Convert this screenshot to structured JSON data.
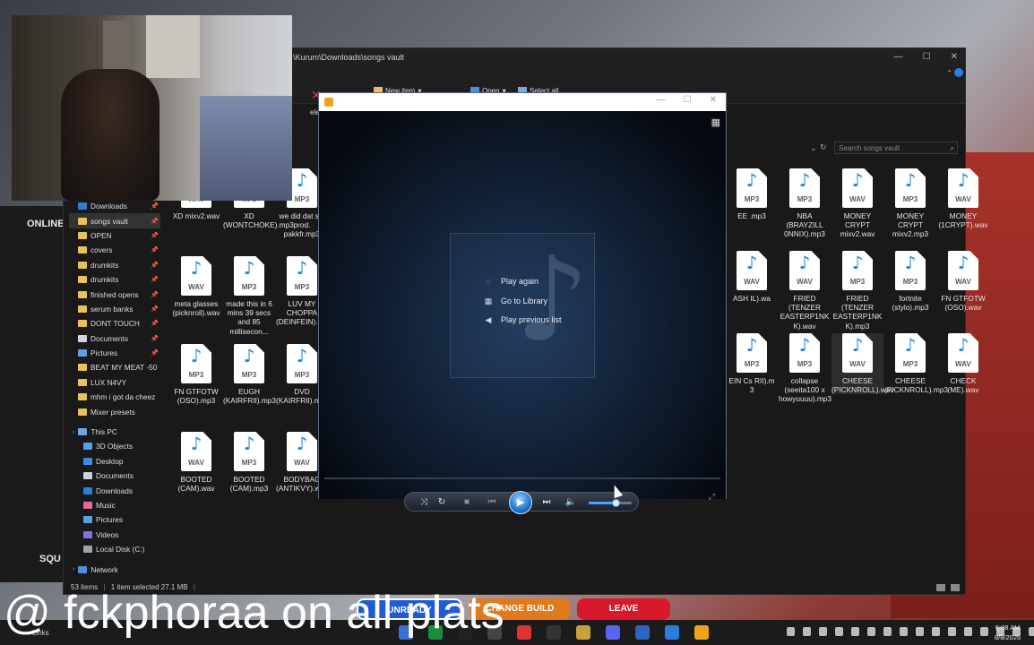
{
  "explorer": {
    "address": "\\Kurum\\Downloads\\songs vault",
    "search_placeholder": "Search songs vault",
    "ribbon": {
      "delete_label": "elete",
      "new_item_label": "New item",
      "open_label": "Open",
      "select_all_label": "Select all"
    },
    "sidebar": {
      "quick_access": [
        {
          "label": "Downloads",
          "pinned": true
        },
        {
          "label": "songs vault",
          "pinned": true,
          "selected": true
        },
        {
          "label": "OPEN",
          "pinned": true
        },
        {
          "label": "covers",
          "pinned": true
        },
        {
          "label": "drumkits",
          "pinned": true
        },
        {
          "label": "drumkits",
          "pinned": true
        },
        {
          "label": "finished opens",
          "pinned": true
        },
        {
          "label": "serum banks",
          "pinned": true
        },
        {
          "label": "DONT TOUCH",
          "pinned": true
        },
        {
          "label": "Documents",
          "pinned": true
        },
        {
          "label": "Pictures",
          "pinned": true
        },
        {
          "label": "BEAT MY MEAT -50",
          "pinned": false
        },
        {
          "label": "LUX N4VY",
          "pinned": false
        },
        {
          "label": "mhm i got da cheez",
          "pinned": false
        },
        {
          "label": "Mixer presets",
          "pinned": false
        }
      ],
      "this_pc_label": "This PC",
      "this_pc": [
        "3D Objects",
        "Desktop",
        "Documents",
        "Downloads",
        "Music",
        "Pictures",
        "Videos",
        "Local Disk (C:)"
      ],
      "network_label": "Network"
    },
    "files_left": [
      {
        "name": "XD mixv2.wav",
        "ext": "WAV",
        "col": 0,
        "row": 0
      },
      {
        "name": "XD (WONTCHOKE).mp3",
        "ext": "MP3",
        "col": 1,
        "row": 0
      },
      {
        "name": "we did dat shi prod. pakkfr.mp3",
        "ext": "MP3",
        "col": 2,
        "row": 0
      },
      {
        "name": "meta glasses (picknroll).wav",
        "ext": "WAV",
        "col": 0,
        "row": 1
      },
      {
        "name": "made this in 6 mins 39 secs and 85 millisecon...",
        "ext": "MP3",
        "col": 1,
        "row": 1
      },
      {
        "name": "LUV MY CHOPPA (DEINFEIN).mp3",
        "ext": "MP3",
        "col": 2,
        "row": 1
      },
      {
        "name": "FN GTFOTW (OSO).mp3",
        "ext": "MP3",
        "col": 0,
        "row": 2
      },
      {
        "name": "EUGH (KAIRFRII).mp3",
        "ext": "MP3",
        "col": 1,
        "row": 2
      },
      {
        "name": "DVD (KAIRFRII).mp3",
        "ext": "MP3",
        "col": 2,
        "row": 2
      },
      {
        "name": "BOOTED (CAM).wav",
        "ext": "WAV",
        "col": 0,
        "row": 3
      },
      {
        "name": "BOOTED (CAM).mp3",
        "ext": "MP3",
        "col": 1,
        "row": 3
      },
      {
        "name": "BODYBAG (ANTIKVY).wav",
        "ext": "WAV",
        "col": 2,
        "row": 3
      }
    ],
    "files_right": [
      {
        "name": "EE .mp3",
        "ext": "MP3",
        "col": 0,
        "row": 0
      },
      {
        "name": "NBA (BRAYZILL 0NNIX).mp3",
        "ext": "MP3",
        "col": 1,
        "row": 0
      },
      {
        "name": "MONEY CRYPT mixv2.wav",
        "ext": "WAV",
        "col": 2,
        "row": 0
      },
      {
        "name": "MONEY CRYPT mixv2.mp3",
        "ext": "MP3",
        "col": 3,
        "row": 0
      },
      {
        "name": "MONEY (1CRYPT).wav",
        "ext": "WAV",
        "col": 4,
        "row": 0
      },
      {
        "name": "ASH IL).wa",
        "ext": "WAV",
        "col": 0,
        "row": 1
      },
      {
        "name": "FRIED (TENZER EASTERP1NK K).wav",
        "ext": "WAV",
        "col": 1,
        "row": 1
      },
      {
        "name": "FRIED (TENZER EASTERP1NK K).mp3",
        "ext": "MP3",
        "col": 2,
        "row": 1
      },
      {
        "name": "fortnite (stylo).mp3",
        "ext": "MP3",
        "col": 3,
        "row": 1
      },
      {
        "name": "FN GTFOTW (OSO).wav",
        "ext": "WAV",
        "col": 4,
        "row": 1
      },
      {
        "name": "EIN Cs RII).m 3",
        "ext": "MP3",
        "col": 0,
        "row": 2
      },
      {
        "name": "collapse (seeita100 x howyuuuu).mp3",
        "ext": "MP3",
        "col": 1,
        "row": 2
      },
      {
        "name": "CHEESE (PICKNROLL).wav",
        "ext": "WAV",
        "col": 2,
        "row": 2,
        "selected": true
      },
      {
        "name": "CHEESE (PICKNROLL).mp3",
        "ext": "MP3",
        "col": 3,
        "row": 2
      },
      {
        "name": "CHECK (ME).wav",
        "ext": "WAV",
        "col": 4,
        "row": 2
      }
    ],
    "status": {
      "items": "53 items",
      "selected": "1 item selected  27.1 MB"
    }
  },
  "player": {
    "menu": [
      {
        "label": "Play again",
        "icon": "replay-icon"
      },
      {
        "label": "Go to Library",
        "icon": "library-icon"
      },
      {
        "label": "Play previous list",
        "icon": "back-arrow-icon"
      }
    ],
    "volume_level": 0.62
  },
  "overlay": {
    "online_label": "ONLINE",
    "squad_label": "SQU",
    "buttons": [
      {
        "label": "UNREADY",
        "color": "#1f5bd8"
      },
      {
        "label": "CHANGE BUILD",
        "color": "#e07a1c"
      },
      {
        "label": "LEAVE",
        "color": "#d8192b"
      }
    ],
    "watermark": "@ fckphoraa on all plats"
  },
  "taskbar": {
    "links_label": "Links",
    "time": "6:08 AM",
    "date": "8/8/2026",
    "icon_colors": [
      "#3a6fd8",
      "#1d8d3c",
      "#222",
      "#444",
      "#d33",
      "#333",
      "#c8a33a",
      "#5865f2",
      "#2b66c7",
      "#2a7de1",
      "#f0a21b"
    ]
  }
}
